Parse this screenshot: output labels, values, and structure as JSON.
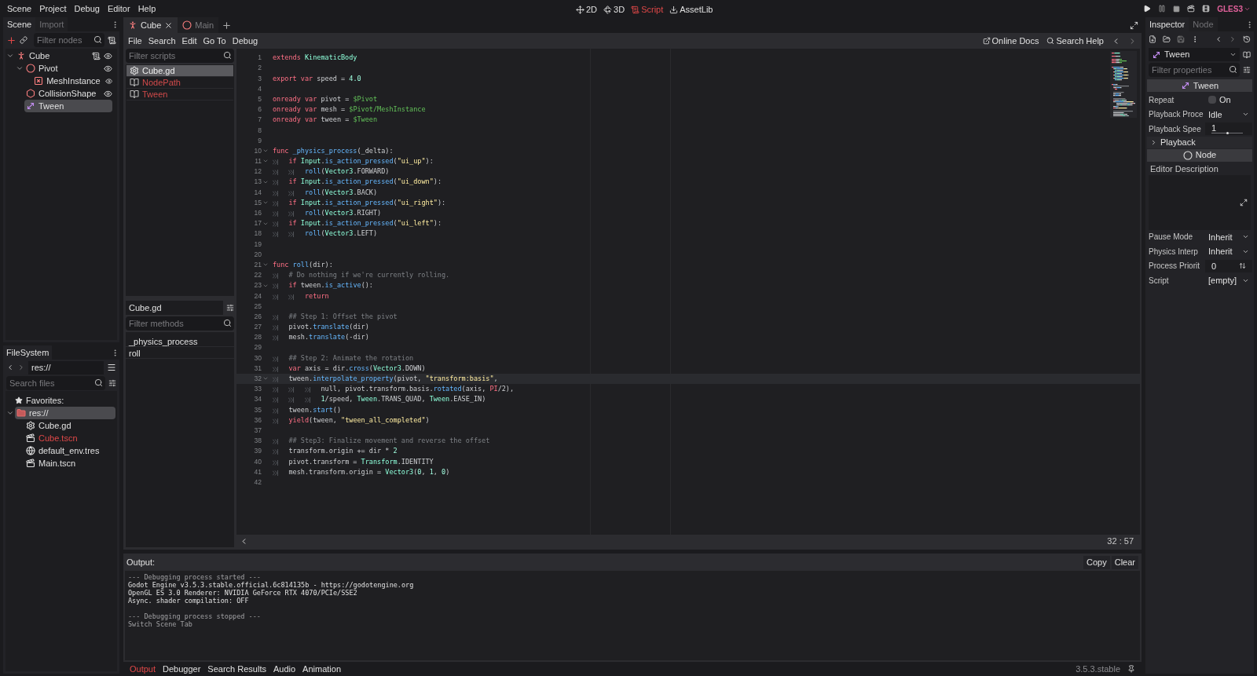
{
  "menu": [
    "Scene",
    "Project",
    "Debug",
    "Editor",
    "Help"
  ],
  "workspaces": [
    {
      "label": "2D",
      "kind": "planar",
      "selected": false
    },
    {
      "label": "3D",
      "kind": "spatial",
      "selected": false
    },
    {
      "label": "Script",
      "kind": "script",
      "selected": true
    },
    {
      "label": "AssetLib",
      "kind": "assetlib",
      "selected": false
    }
  ],
  "renderer": "GLES3",
  "scene_dock": {
    "tabs": [
      {
        "label": "Scene",
        "selected": true
      },
      {
        "label": "Import",
        "selected": false
      }
    ],
    "filter": {
      "placeholder": "Filter nodes"
    },
    "tree": [
      {
        "label": "Cube",
        "kind": "kinematic",
        "selected": false,
        "expanded": true,
        "script": true,
        "eye": true,
        "children": [
          {
            "label": "Pivot",
            "kind": "spatial",
            "selected": false,
            "expanded": true,
            "script": false,
            "eye": true,
            "children": [
              {
                "label": "MeshInstance",
                "kind": "mesh",
                "selected": false,
                "script": false,
                "eye": true
              }
            ]
          },
          {
            "label": "CollisionShape",
            "kind": "collision",
            "selected": false,
            "script": false,
            "eye": true
          },
          {
            "label": "Tween",
            "kind": "tween",
            "selected": true,
            "script": false,
            "eye": false
          }
        ]
      }
    ]
  },
  "filesystem": {
    "tab": "FileSystem",
    "path": "res://",
    "search": {
      "placeholder": "Search files"
    },
    "favorites": "Favorites:",
    "tree": [
      {
        "label": "res://",
        "kind": "folder",
        "selected": true,
        "expanded": true,
        "modified": false,
        "children": [
          {
            "label": "Cube.gd",
            "kind": "script",
            "selected": false,
            "modified": false
          },
          {
            "label": "Cube.tscn",
            "kind": "scene",
            "selected": false,
            "modified": true
          },
          {
            "label": "default_env.tres",
            "kind": "resource",
            "selected": false,
            "modified": false
          },
          {
            "label": "Main.tscn",
            "kind": "scene",
            "selected": false,
            "modified": false
          }
        ]
      }
    ]
  },
  "scene_tabs": [
    {
      "label": "Cube",
      "kind": "kinematic",
      "selected": true
    },
    {
      "label": "Main",
      "kind": "spatial",
      "selected": false
    }
  ],
  "script_menu": [
    "File",
    "Search",
    "Edit",
    "Go To",
    "Debug"
  ],
  "help_links": [
    {
      "label": "Online Docs",
      "kind": "docs"
    },
    {
      "label": "Search Help",
      "kind": "help"
    }
  ],
  "script_list": {
    "filter": {
      "placeholder": "Filter scripts"
    },
    "items": [
      {
        "label": "Cube.gd",
        "kind": "script",
        "selected": true
      },
      {
        "label": "NodePath",
        "kind": "doc",
        "selected": false
      },
      {
        "label": "Tween",
        "kind": "doc",
        "selected": false
      }
    ]
  },
  "methods": {
    "script": "Cube.gd",
    "filter": {
      "placeholder": "Filter methods"
    },
    "items": [
      "_physics_process",
      "roll"
    ]
  },
  "editor": {
    "cursor": "32 : 57",
    "lines": [
      {
        "number": "1",
        "fold": false,
        "current": false,
        "tokens": [
          {
            "kind": "keyword",
            "text": "extends"
          },
          {
            "kind": "type",
            "text": " KinematicBody"
          }
        ]
      },
      {
        "number": "2",
        "fold": false,
        "current": false
      },
      {
        "number": "3",
        "fold": false,
        "current": false,
        "tokens": [
          {
            "kind": "keyword",
            "text": "export"
          },
          {
            "kind": "keyword",
            "text": " var"
          },
          {
            "kind": "plain",
            "text": " speed = "
          },
          {
            "kind": "number",
            "text": "4.0"
          }
        ]
      },
      {
        "number": "4",
        "fold": false,
        "current": false
      },
      {
        "number": "5",
        "fold": false,
        "current": false,
        "tokens": [
          {
            "kind": "keyword",
            "text": "onready"
          },
          {
            "kind": "keyword",
            "text": " var"
          },
          {
            "kind": "plain",
            "text": " pivot = "
          },
          {
            "kind": "nodepath",
            "text": "$Pivot"
          }
        ]
      },
      {
        "number": "6",
        "fold": false,
        "current": false,
        "tokens": [
          {
            "kind": "keyword",
            "text": "onready"
          },
          {
            "kind": "keyword",
            "text": " var"
          },
          {
            "kind": "plain",
            "text": " mesh = "
          },
          {
            "kind": "nodepath",
            "text": "$Pivot/MeshInstance"
          }
        ]
      },
      {
        "number": "7",
        "fold": false,
        "current": false,
        "tokens": [
          {
            "kind": "keyword",
            "text": "onready"
          },
          {
            "kind": "keyword",
            "text": " var"
          },
          {
            "kind": "plain",
            "text": " tween = "
          },
          {
            "kind": "nodepath",
            "text": "$Tween"
          }
        ]
      },
      {
        "number": "8",
        "fold": false,
        "current": false
      },
      {
        "number": "9",
        "fold": false,
        "current": false
      },
      {
        "number": "10",
        "fold": true,
        "current": false,
        "tokens": [
          {
            "kind": "keyword",
            "text": "func"
          },
          {
            "kind": "function",
            "text": " _physics_process"
          },
          {
            "kind": "plain",
            "text": "(_delta):"
          }
        ]
      },
      {
        "number": "11",
        "fold": true,
        "current": false,
        "tokens": [
          {
            "kind": "keyword",
            "text": "\tif"
          },
          {
            "kind": "type",
            "text": " Input"
          },
          {
            "kind": "plain",
            "text": "."
          },
          {
            "kind": "function",
            "text": "is_action_pressed"
          },
          {
            "kind": "plain",
            "text": "("
          },
          {
            "kind": "string",
            "text": "\"ui_up\""
          },
          {
            "kind": "plain",
            "text": "):"
          }
        ]
      },
      {
        "number": "12",
        "fold": false,
        "current": false,
        "tokens": [
          {
            "kind": "function",
            "text": "\t\troll"
          },
          {
            "kind": "plain",
            "text": "("
          },
          {
            "kind": "type",
            "text": "Vector3"
          },
          {
            "kind": "plain",
            "text": ".FORWARD)"
          }
        ]
      },
      {
        "number": "13",
        "fold": true,
        "current": false,
        "tokens": [
          {
            "kind": "keyword",
            "text": "\tif"
          },
          {
            "kind": "type",
            "text": " Input"
          },
          {
            "kind": "plain",
            "text": "."
          },
          {
            "kind": "function",
            "text": "is_action_pressed"
          },
          {
            "kind": "plain",
            "text": "("
          },
          {
            "kind": "string",
            "text": "\"ui_down\""
          },
          {
            "kind": "plain",
            "text": "):"
          }
        ]
      },
      {
        "number": "14",
        "fold": false,
        "current": false,
        "tokens": [
          {
            "kind": "function",
            "text": "\t\troll"
          },
          {
            "kind": "plain",
            "text": "("
          },
          {
            "kind": "type",
            "text": "Vector3"
          },
          {
            "kind": "plain",
            "text": ".BACK)"
          }
        ]
      },
      {
        "number": "15",
        "fold": true,
        "current": false,
        "tokens": [
          {
            "kind": "keyword",
            "text": "\tif"
          },
          {
            "kind": "type",
            "text": " Input"
          },
          {
            "kind": "plain",
            "text": "."
          },
          {
            "kind": "function",
            "text": "is_action_pressed"
          },
          {
            "kind": "plain",
            "text": "("
          },
          {
            "kind": "string",
            "text": "\"ui_right\""
          },
          {
            "kind": "plain",
            "text": "):"
          }
        ]
      },
      {
        "number": "16",
        "fold": false,
        "current": false,
        "tokens": [
          {
            "kind": "function",
            "text": "\t\troll"
          },
          {
            "kind": "plain",
            "text": "("
          },
          {
            "kind": "type",
            "text": "Vector3"
          },
          {
            "kind": "plain",
            "text": ".RIGHT)"
          }
        ]
      },
      {
        "number": "17",
        "fold": true,
        "current": false,
        "tokens": [
          {
            "kind": "keyword",
            "text": "\tif"
          },
          {
            "kind": "type",
            "text": " Input"
          },
          {
            "kind": "plain",
            "text": "."
          },
          {
            "kind": "function",
            "text": "is_action_pressed"
          },
          {
            "kind": "plain",
            "text": "("
          },
          {
            "kind": "string",
            "text": "\"ui_left\""
          },
          {
            "kind": "plain",
            "text": "):"
          }
        ]
      },
      {
        "number": "18",
        "fold": false,
        "current": false,
        "tokens": [
          {
            "kind": "function",
            "text": "\t\troll"
          },
          {
            "kind": "plain",
            "text": "("
          },
          {
            "kind": "type",
            "text": "Vector3"
          },
          {
            "kind": "plain",
            "text": ".LEFT)"
          }
        ]
      },
      {
        "number": "19",
        "fold": false,
        "current": false
      },
      {
        "number": "20",
        "fold": false,
        "current": false
      },
      {
        "number": "21",
        "fold": true,
        "current": false,
        "tokens": [
          {
            "kind": "keyword",
            "text": "func"
          },
          {
            "kind": "function",
            "text": " roll"
          },
          {
            "kind": "plain",
            "text": "(dir):"
          }
        ]
      },
      {
        "number": "22",
        "fold": false,
        "current": false,
        "tokens": [
          {
            "kind": "comment",
            "text": "\t# Do nothing if we're currently rolling."
          }
        ]
      },
      {
        "number": "23",
        "fold": true,
        "current": false,
        "tokens": [
          {
            "kind": "keyword",
            "text": "\tif"
          },
          {
            "kind": "plain",
            "text": " tween."
          },
          {
            "kind": "function",
            "text": "is_active"
          },
          {
            "kind": "plain",
            "text": "():"
          }
        ]
      },
      {
        "number": "24",
        "fold": false,
        "current": false,
        "tokens": [
          {
            "kind": "keyword",
            "text": "\t\treturn"
          }
        ]
      },
      {
        "number": "25",
        "fold": false,
        "current": false
      },
      {
        "number": "26",
        "fold": false,
        "current": false,
        "tokens": [
          {
            "kind": "comment",
            "text": "\t## Step 1: Offset the pivot"
          }
        ]
      },
      {
        "number": "27",
        "fold": false,
        "current": false,
        "tokens": [
          {
            "kind": "plain",
            "text": "\tpivot."
          },
          {
            "kind": "function",
            "text": "translate"
          },
          {
            "kind": "plain",
            "text": "(dir)"
          }
        ]
      },
      {
        "number": "28",
        "fold": false,
        "current": false,
        "tokens": [
          {
            "kind": "plain",
            "text": "\tmesh."
          },
          {
            "kind": "function",
            "text": "translate"
          },
          {
            "kind": "plain",
            "text": "(-dir)"
          }
        ]
      },
      {
        "number": "29",
        "fold": false,
        "current": false
      },
      {
        "number": "30",
        "fold": false,
        "current": false,
        "tokens": [
          {
            "kind": "comment",
            "text": "\t## Step 2: Animate the rotation"
          }
        ]
      },
      {
        "number": "31",
        "fold": false,
        "current": false,
        "tokens": [
          {
            "kind": "keyword",
            "text": "\tvar"
          },
          {
            "kind": "plain",
            "text": " axis = dir."
          },
          {
            "kind": "function",
            "text": "cross"
          },
          {
            "kind": "plain",
            "text": "("
          },
          {
            "kind": "type",
            "text": "Vector3"
          },
          {
            "kind": "plain",
            "text": ".DOWN)"
          }
        ]
      },
      {
        "number": "32",
        "fold": true,
        "current": true,
        "tokens": [
          {
            "kind": "plain",
            "text": "\ttween."
          },
          {
            "kind": "function",
            "text": "interpolate_property"
          },
          {
            "kind": "plain",
            "text": "(pivot, "
          },
          {
            "kind": "string",
            "text": "\"transform:basis\""
          },
          {
            "kind": "plain",
            "text": ","
          }
        ]
      },
      {
        "number": "33",
        "fold": false,
        "current": false,
        "tokens": [
          {
            "kind": "plain",
            "text": "\t\t\tnull, pivot.transform.basis."
          },
          {
            "kind": "function",
            "text": "rotated"
          },
          {
            "kind": "plain",
            "text": "(axis, "
          },
          {
            "kind": "keyword",
            "text": "PI"
          },
          {
            "kind": "plain",
            "text": "/2),"
          }
        ]
      },
      {
        "number": "34",
        "fold": false,
        "current": false,
        "tokens": [
          {
            "kind": "number",
            "text": "\t\t\t1"
          },
          {
            "kind": "plain",
            "text": "/speed, "
          },
          {
            "kind": "type",
            "text": "Tween"
          },
          {
            "kind": "plain",
            "text": ".TRANS_QUAD, "
          },
          {
            "kind": "type",
            "text": "Tween"
          },
          {
            "kind": "plain",
            "text": ".EASE_IN)"
          }
        ]
      },
      {
        "number": "35",
        "fold": false,
        "current": false,
        "tokens": [
          {
            "kind": "plain",
            "text": "\ttween."
          },
          {
            "kind": "function",
            "text": "start"
          },
          {
            "kind": "plain",
            "text": "()"
          }
        ]
      },
      {
        "number": "36",
        "fold": false,
        "current": false,
        "tokens": [
          {
            "kind": "keyword",
            "text": "\tyield"
          },
          {
            "kind": "plain",
            "text": "(tween, "
          },
          {
            "kind": "string",
            "text": "\"tween_all_completed\""
          },
          {
            "kind": "plain",
            "text": ")"
          }
        ]
      },
      {
        "number": "37",
        "fold": false,
        "current": false
      },
      {
        "number": "38",
        "fold": false,
        "current": false,
        "tokens": [
          {
            "kind": "comment",
            "text": "\t## Step3: Finalize movement and reverse the offset"
          }
        ]
      },
      {
        "number": "39",
        "fold": false,
        "current": false,
        "tokens": [
          {
            "kind": "plain",
            "text": "\ttransform.origin += dir * "
          },
          {
            "kind": "number",
            "text": "2"
          }
        ]
      },
      {
        "number": "40",
        "fold": false,
        "current": false,
        "tokens": [
          {
            "kind": "plain",
            "text": "\tpivot.transform = "
          },
          {
            "kind": "type",
            "text": "Transform"
          },
          {
            "kind": "plain",
            "text": ".IDENTITY"
          }
        ]
      },
      {
        "number": "41",
        "fold": false,
        "current": false,
        "tokens": [
          {
            "kind": "plain",
            "text": "\tmesh.transform.origin = "
          },
          {
            "kind": "type",
            "text": "Vector3"
          },
          {
            "kind": "plain",
            "text": "("
          },
          {
            "kind": "number",
            "text": "0"
          },
          {
            "kind": "plain",
            "text": ", "
          },
          {
            "kind": "number",
            "text": "1"
          },
          {
            "kind": "plain",
            "text": ", "
          },
          {
            "kind": "number",
            "text": "0"
          },
          {
            "kind": "plain",
            "text": ")"
          }
        ]
      },
      {
        "number": "42",
        "fold": false,
        "current": false
      }
    ]
  },
  "output": {
    "title": "Output:",
    "buttons": [
      "Copy",
      "Clear"
    ],
    "lines": [
      {
        "kind": "header",
        "text": "--- Debugging process started ---"
      },
      {
        "kind": "text",
        "text": "Godot Engine v3.5.3.stable.official.6c814135b - https://godotengine.org"
      },
      {
        "kind": "text",
        "text": "OpenGL ES 3.0 Renderer: NVIDIA GeForce RTX 4070/PCIe/SSE2"
      },
      {
        "kind": "text",
        "text": "Async. shader compilation: OFF"
      },
      {
        "kind": "header",
        "text": "--- Debugging process stopped ---"
      },
      {
        "kind": "note",
        "text": "Switch Scene Tab"
      }
    ]
  },
  "bottom_tabs": [
    {
      "label": "Output",
      "selected": true
    },
    {
      "label": "Debugger",
      "selected": false
    },
    {
      "label": "Search Results",
      "selected": false
    },
    {
      "label": "Audio",
      "selected": false
    },
    {
      "label": "Animation",
      "selected": false
    }
  ],
  "version": "3.5.3.stable",
  "inspector": {
    "tabs": [
      {
        "label": "Inspector",
        "selected": true
      },
      {
        "label": "Node",
        "selected": false
      }
    ],
    "object": "Tween",
    "filter": {
      "placeholder": "Filter properties"
    },
    "rows": [
      {
        "kind": "category",
        "label": "Tween"
      },
      {
        "kind": "check",
        "label": "Repeat",
        "value": "On",
        "checked": false
      },
      {
        "kind": "select",
        "label": "Playback Proce",
        "value": "Idle"
      },
      {
        "kind": "slider",
        "label": "Playback Spee",
        "value": "1",
        "level": 0.52
      },
      {
        "kind": "section",
        "label": "Playback",
        "expanded": false
      },
      {
        "kind": "category",
        "label": "Node"
      },
      {
        "kind": "textarea",
        "label": "Editor Description"
      },
      {
        "kind": "select",
        "label": "Pause Mode",
        "value": "Inherit"
      },
      {
        "kind": "select",
        "label": "Physics Interp",
        "value": "Inherit"
      },
      {
        "kind": "spin",
        "label": "Process Priorit",
        "value": "0"
      },
      {
        "kind": "select",
        "label": "Script",
        "value": "[empty]"
      }
    ]
  }
}
